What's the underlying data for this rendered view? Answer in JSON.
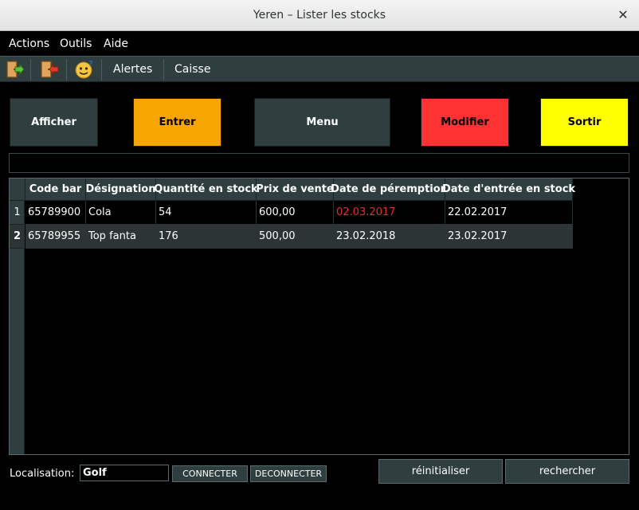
{
  "window": {
    "title": "Yeren – Lister les stocks",
    "close_glyph": "✕"
  },
  "menu": [
    "Actions",
    "Outils",
    "Aide"
  ],
  "toolbar": {
    "icons": [
      "exit-door-icon",
      "login-door-icon",
      "smiley-help-icon"
    ],
    "text_buttons": [
      "Alertes",
      "Caisse"
    ]
  },
  "actions": [
    {
      "label": "Afficher",
      "bg": "#2f3e3e",
      "fg": "#ffffff"
    },
    {
      "label": "Entrer",
      "bg": "#f7a500",
      "fg": "#000000"
    },
    {
      "label": "Menu",
      "bg": "#2f3e3e",
      "fg": "#ffffff"
    },
    {
      "label": "Modifier",
      "bg": "#fe3232",
      "fg": "#000000"
    },
    {
      "label": "Sortir",
      "bg": "#ffff00",
      "fg": "#000000"
    }
  ],
  "table": {
    "columns": [
      "Code bar",
      "Désignation",
      "Quantité en stock",
      "Prix de vente",
      "Date de péremption",
      "Date d'entrée en stock"
    ],
    "rows": [
      {
        "num": "1",
        "cells": [
          "65789900",
          "Cola",
          "54",
          "600,00",
          "02.03.2017",
          "22.02.2017"
        ],
        "expired": true
      },
      {
        "num": "2",
        "cells": [
          "65789955",
          "Top fanta",
          "176",
          "500,00",
          "23.02.2018",
          "23.02.2017"
        ],
        "expired": false
      }
    ],
    "expired_color": "#e03030",
    "row_alt_bg": "#2c3434"
  },
  "bottom": {
    "location_label": "Localisation:",
    "location_value": "Golf",
    "connect": "CONNECTER",
    "disconnect": "DECONNECTER",
    "reset": "réinitialiser",
    "search": "rechercher"
  }
}
